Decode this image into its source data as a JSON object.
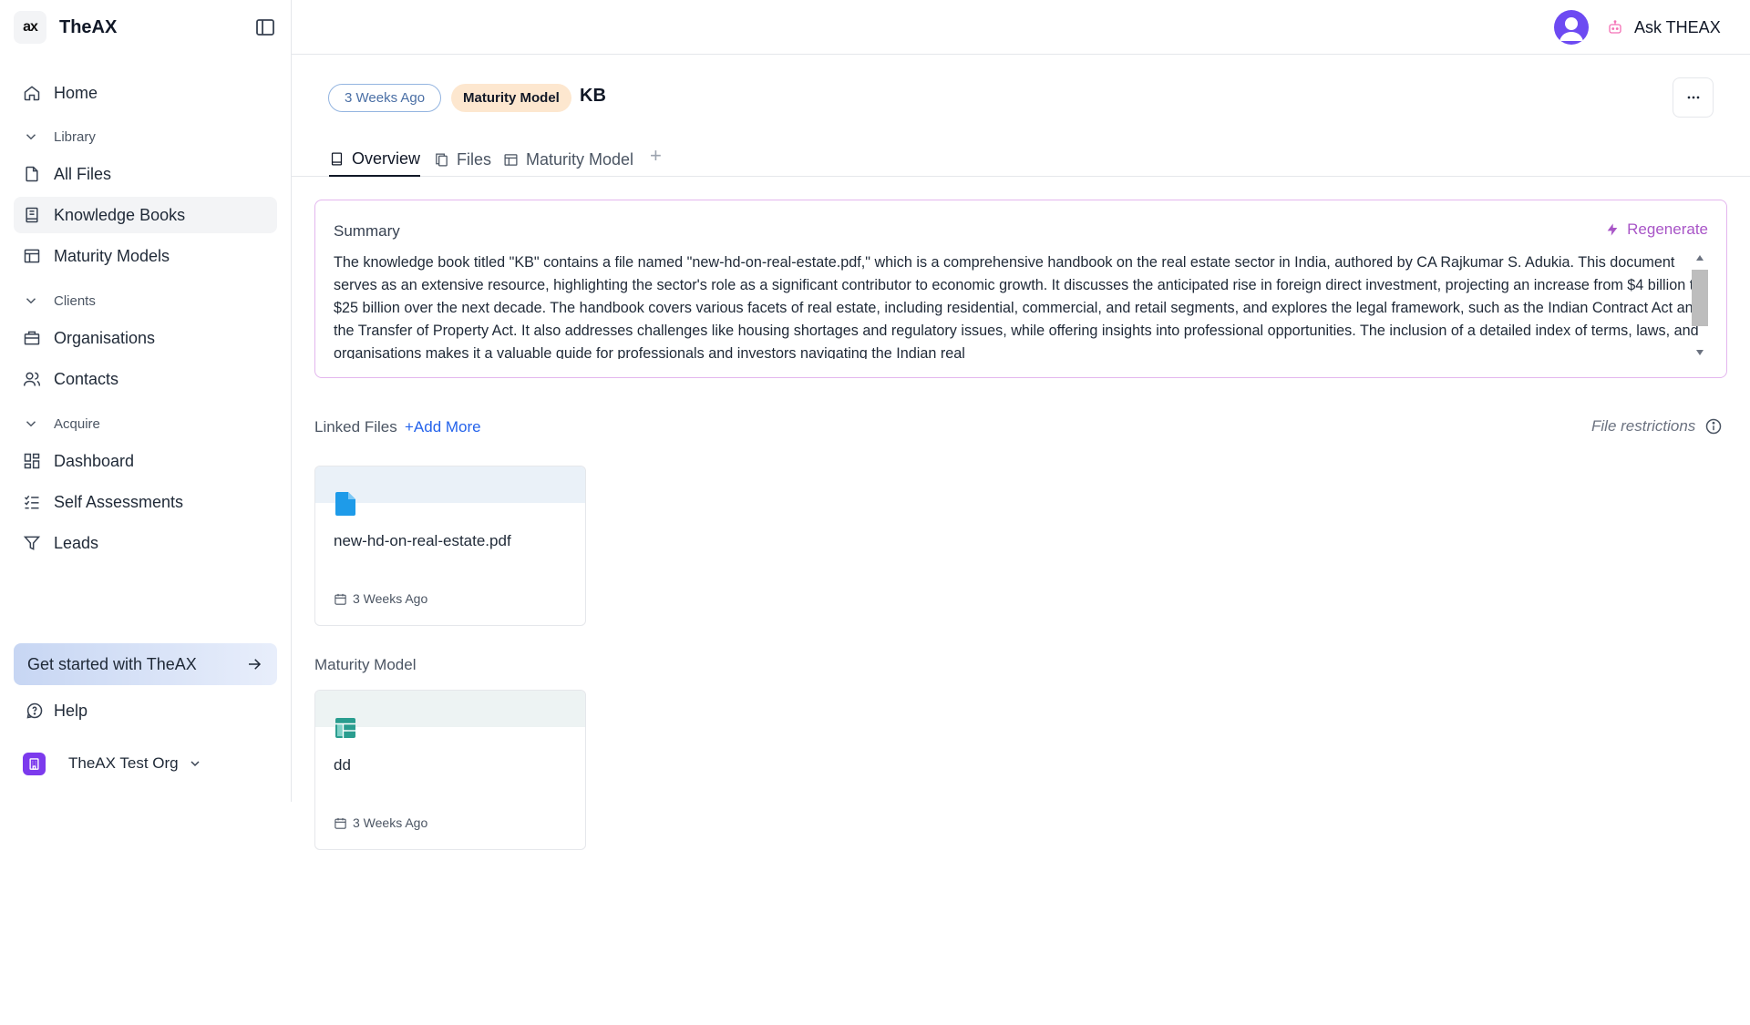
{
  "app": {
    "name": "TheAX",
    "logo_text": "ax"
  },
  "sidebar": {
    "items": [
      {
        "label": "Home",
        "icon": "home-icon"
      },
      {
        "label": "All Files",
        "icon": "file-icon"
      },
      {
        "label": "Knowledge Books",
        "icon": "book-icon",
        "active": true
      },
      {
        "label": "Maturity Models",
        "icon": "table-icon"
      },
      {
        "label": "Organisations",
        "icon": "building-icon"
      },
      {
        "label": "Contacts",
        "icon": "users-icon"
      },
      {
        "label": "Dashboard",
        "icon": "dashboard-icon"
      },
      {
        "label": "Self Assessments",
        "icon": "checklist-icon"
      },
      {
        "label": "Leads",
        "icon": "filter-icon"
      }
    ],
    "sections": {
      "library": "Library",
      "clients": "Clients",
      "acquire": "Acquire"
    },
    "get_started": "Get started with TheAX",
    "help": "Help",
    "org_name": "TheAX Test Org"
  },
  "topbar": {
    "ask_label": "Ask THEAX"
  },
  "header": {
    "date_pill": "3 Weeks Ago",
    "type_pill": "Maturity Model",
    "title": "KB"
  },
  "tabs": [
    {
      "label": "Overview",
      "icon": "book-icon",
      "active": true
    },
    {
      "label": "Files",
      "icon": "files-icon"
    },
    {
      "label": "Maturity Model",
      "icon": "table-icon"
    }
  ],
  "tab_add": "+",
  "summary": {
    "title": "Summary",
    "regenerate": "Regenerate",
    "text": "The knowledge book titled \"KB\" contains a file named \"new-hd-on-real-estate.pdf,\" which is a comprehensive handbook on the real estate sector in India, authored by CA Rajkumar S. Adukia. This document serves as an extensive resource, highlighting the sector's role as a significant contributor to economic growth. It discusses the anticipated rise in foreign direct investment, projecting an increase from $4 billion to $25 billion over the next decade. The handbook covers various facets of real estate, including residential, commercial, and retail segments, and explores the legal framework, such as the Indian Contract Act and the Transfer of Property Act. It also addresses challenges like housing shortages and regulatory issues, while offering insights into professional opportunities. The inclusion of a detailed index of terms, laws, and organisations makes it a valuable guide for professionals and investors navigating the Indian real"
  },
  "linked_files": {
    "label": "Linked Files",
    "add_more": "+Add More",
    "restrictions": "File restrictions",
    "files": [
      {
        "name": "new-hd-on-real-estate.pdf",
        "date": "3 Weeks Ago"
      }
    ]
  },
  "maturity_model": {
    "label": "Maturity Model",
    "items": [
      {
        "name": "dd",
        "date": "3 Weeks Ago"
      }
    ]
  },
  "colors": {
    "accent_purple": "#a855c7",
    "link_blue": "#2563eb",
    "file_icon_blue": "#1e9be9",
    "table_icon_teal": "#2a9d8f",
    "avatar_purple": "#6d4af2"
  }
}
